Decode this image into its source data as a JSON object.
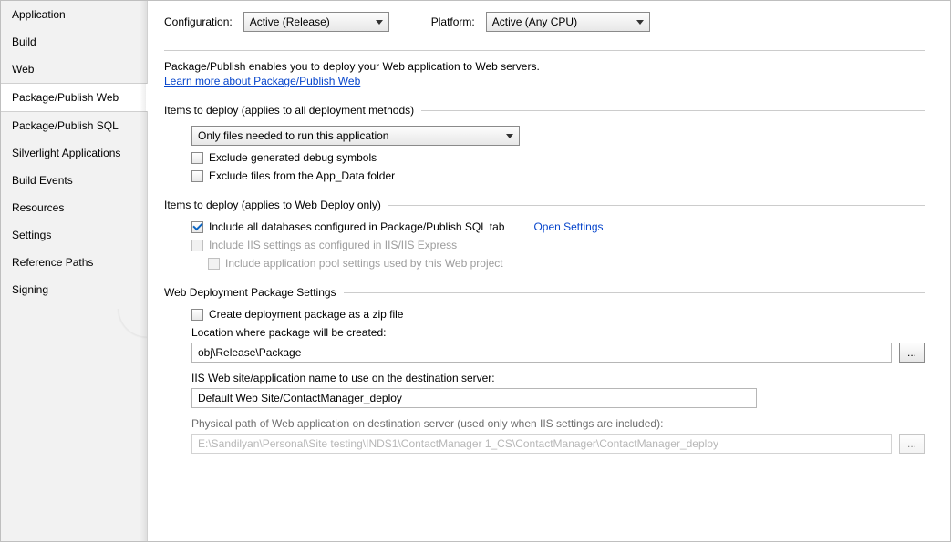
{
  "sidebar": {
    "items": [
      {
        "label": "Application"
      },
      {
        "label": "Build"
      },
      {
        "label": "Web"
      },
      {
        "label": "Package/Publish Web"
      },
      {
        "label": "Package/Publish SQL"
      },
      {
        "label": "Silverlight Applications"
      },
      {
        "label": "Build Events"
      },
      {
        "label": "Resources"
      },
      {
        "label": "Settings"
      },
      {
        "label": "Reference Paths"
      },
      {
        "label": "Signing"
      }
    ],
    "activeIndex": 3
  },
  "top": {
    "configuration_label": "Configuration:",
    "configuration_value": "Active (Release)",
    "platform_label": "Platform:",
    "platform_value": "Active (Any CPU)"
  },
  "intro": {
    "text": "Package/Publish enables you to deploy your Web application to Web servers.",
    "link": "Learn more about Package/Publish Web"
  },
  "sections": {
    "items_all_title": "Items to deploy (applies to all deployment methods)",
    "deploy_mode_value": "Only files needed to run this application",
    "exclude_debug": "Exclude generated debug symbols",
    "exclude_appdata": "Exclude files from the App_Data folder",
    "items_webdeploy_title": "Items to deploy (applies to Web Deploy only)",
    "include_databases": "Include all databases configured in Package/Publish SQL tab",
    "open_settings": "Open Settings",
    "include_iis": "Include IIS settings as configured in IIS/IIS Express",
    "include_apppool": "Include application pool settings used by this Web project",
    "pkg_title": "Web Deployment Package Settings",
    "create_zip": "Create deployment package as a zip file",
    "location_label": "Location where package will be created:",
    "location_value": "obj\\Release\\Package",
    "browse_label": "...",
    "iis_name_label": "IIS Web site/application name to use on the destination server:",
    "iis_name_value": "Default Web Site/ContactManager_deploy",
    "phys_path_label": "Physical path of Web application on destination server (used only when IIS settings are included):",
    "phys_path_value": "E:\\Sandilyan\\Personal\\Site testing\\INDS1\\ContactManager 1_CS\\ContactManager\\ContactManager_deploy"
  }
}
